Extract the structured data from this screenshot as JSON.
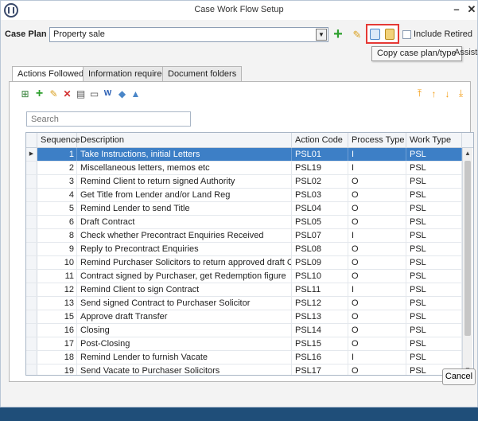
{
  "window": {
    "title": "Case Work Flow Setup",
    "minimize_glyph": "–",
    "close_glyph": "✕"
  },
  "case_plan": {
    "label": "Case Plan",
    "value": "Property sale",
    "include_retired_label": "Include Retired",
    "include_retired_checked": false
  },
  "tooltip": {
    "text": "Copy case plan/type",
    "trailing_text": "Assists"
  },
  "tabs": [
    {
      "label": "Actions Followed",
      "active": true
    },
    {
      "label": "Information required",
      "active": false
    },
    {
      "label": "Document folders",
      "active": false
    }
  ],
  "search": {
    "placeholder": "Search",
    "value": ""
  },
  "grid": {
    "columns": [
      "Sequence",
      "Description",
      "Action Code",
      "Process Type",
      "Work Type"
    ],
    "rows": [
      {
        "sequence": "1",
        "description": "Take Instructions, initial Letters",
        "action_code": "PSL01",
        "process_type": "I",
        "work_type": "PSL",
        "selected": true
      },
      {
        "sequence": "2",
        "description": "Miscellaneous letters, memos etc",
        "action_code": "PSL19",
        "process_type": "I",
        "work_type": "PSL"
      },
      {
        "sequence": "3",
        "description": "Remind Client to return signed Authority",
        "action_code": "PSL02",
        "process_type": "O",
        "work_type": "PSL"
      },
      {
        "sequence": "4",
        "description": "Get Title from Lender and/or Land Reg",
        "action_code": "PSL03",
        "process_type": "O",
        "work_type": "PSL"
      },
      {
        "sequence": "5",
        "description": "Remind Lender to send Title",
        "action_code": "PSL04",
        "process_type": "O",
        "work_type": "PSL"
      },
      {
        "sequence": "6",
        "description": "Draft Contract",
        "action_code": "PSL05",
        "process_type": "O",
        "work_type": "PSL"
      },
      {
        "sequence": "8",
        "description": "Check whether Precontract Enquiries Received",
        "action_code": "PSL07",
        "process_type": "I",
        "work_type": "PSL"
      },
      {
        "sequence": "9",
        "description": "Reply to Precontract Enquiries",
        "action_code": "PSL08",
        "process_type": "O",
        "work_type": "PSL"
      },
      {
        "sequence": "10",
        "description": "Remind Purchaser Solicitors to return approved draft Cont...",
        "action_code": "PSL09",
        "process_type": "O",
        "work_type": "PSL"
      },
      {
        "sequence": "11",
        "description": "Contract signed by Purchaser, get Redemption figure",
        "action_code": "PSL10",
        "process_type": "O",
        "work_type": "PSL"
      },
      {
        "sequence": "12",
        "description": "Remind Client to sign Contract",
        "action_code": "PSL11",
        "process_type": "I",
        "work_type": "PSL"
      },
      {
        "sequence": "13",
        "description": "Send signed Contract to Purchaser Solicitor",
        "action_code": "PSL12",
        "process_type": "O",
        "work_type": "PSL"
      },
      {
        "sequence": "15",
        "description": "Approve draft Transfer",
        "action_code": "PSL13",
        "process_type": "O",
        "work_type": "PSL"
      },
      {
        "sequence": "16",
        "description": "Closing",
        "action_code": "PSL14",
        "process_type": "O",
        "work_type": "PSL"
      },
      {
        "sequence": "17",
        "description": "Post-Closing",
        "action_code": "PSL15",
        "process_type": "O",
        "work_type": "PSL"
      },
      {
        "sequence": "18",
        "description": "Remind Lender to furnish Vacate",
        "action_code": "PSL16",
        "process_type": "I",
        "work_type": "PSL"
      },
      {
        "sequence": "19",
        "description": "Send Vacate to Purchaser Solicitors",
        "action_code": "PSL17",
        "process_type": "O",
        "work_type": "PSL"
      }
    ]
  },
  "buttons": {
    "cancel_label": "Cancel"
  },
  "icons": {
    "add": "plus-icon",
    "edit": "pencil-icon",
    "copy": "copy-case-plan-icon",
    "paste": "paste-icon",
    "toolbar": [
      "new-row-icon",
      "add-icon",
      "edit-icon",
      "delete-icon",
      "print-icon",
      "export-icon",
      "word-icon",
      "filter-icon",
      "move-up-icon",
      "move-top-icon",
      "move-up-arrow-icon",
      "move-down-arrow-icon",
      "move-bottom-icon"
    ]
  },
  "colors": {
    "selected_row": "#3d7fc6",
    "highlight_border": "#e53935",
    "add_green": "#2ea02e",
    "order_orange": "#f39c12"
  }
}
